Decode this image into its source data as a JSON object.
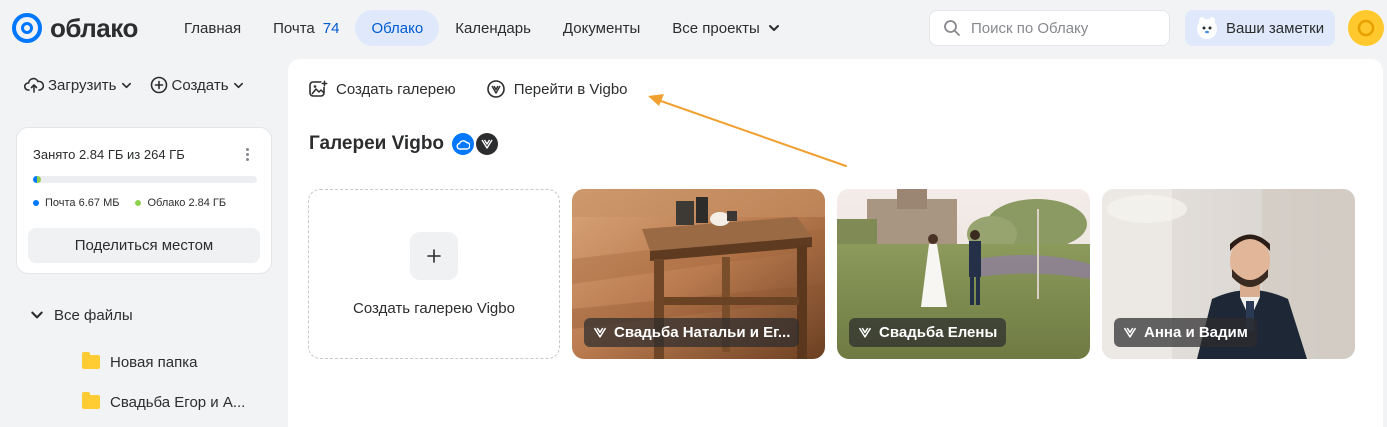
{
  "header": {
    "logo_text": "облако",
    "nav": [
      {
        "label": "Главная",
        "count": "",
        "active": false
      },
      {
        "label": "Почта",
        "count": "74",
        "active": false
      },
      {
        "label": "Облако",
        "count": "",
        "active": true
      },
      {
        "label": "Календарь",
        "count": "",
        "active": false
      },
      {
        "label": "Документы",
        "count": "",
        "active": false
      },
      {
        "label": "Все проекты",
        "count": "",
        "active": false
      }
    ],
    "search_placeholder": "Поиск по Облаку",
    "notes_label": "Ваши заметки"
  },
  "sidebar": {
    "upload_label": "Загрузить",
    "create_label": "Создать",
    "storage": {
      "title": "Занято 2.84 ГБ из 264 ГБ",
      "used_fraction": 0.0108,
      "mail_fraction": 3e-05,
      "legend": [
        {
          "label": "Почта 6.67 МБ",
          "color": "#0077ff"
        },
        {
          "label": "Облако 2.84 ГБ",
          "color": "#8fd14f"
        }
      ],
      "share_label": "Поделиться местом"
    },
    "tree": {
      "root_label": "Все файлы",
      "folders": [
        {
          "label": "Новая папка"
        },
        {
          "label": "Свадьба Егор и А..."
        }
      ]
    }
  },
  "main": {
    "toolbar": {
      "create_gallery_label": "Создать галерею",
      "goto_vigbo_label": "Перейти в Vigbo"
    },
    "section_title": "Галереи Vigbo",
    "new_gallery_label": "Создать галерею Vigbo",
    "galleries": [
      {
        "label": "Свадьба Натальи и Ег..."
      },
      {
        "label": "Свадьба Елены"
      },
      {
        "label": "Анна и Вадим"
      }
    ]
  },
  "colors": {
    "accent": "#0077ff",
    "active_tab_bg": "#dfe9fb",
    "annotation_arrow": "#f0a030"
  }
}
